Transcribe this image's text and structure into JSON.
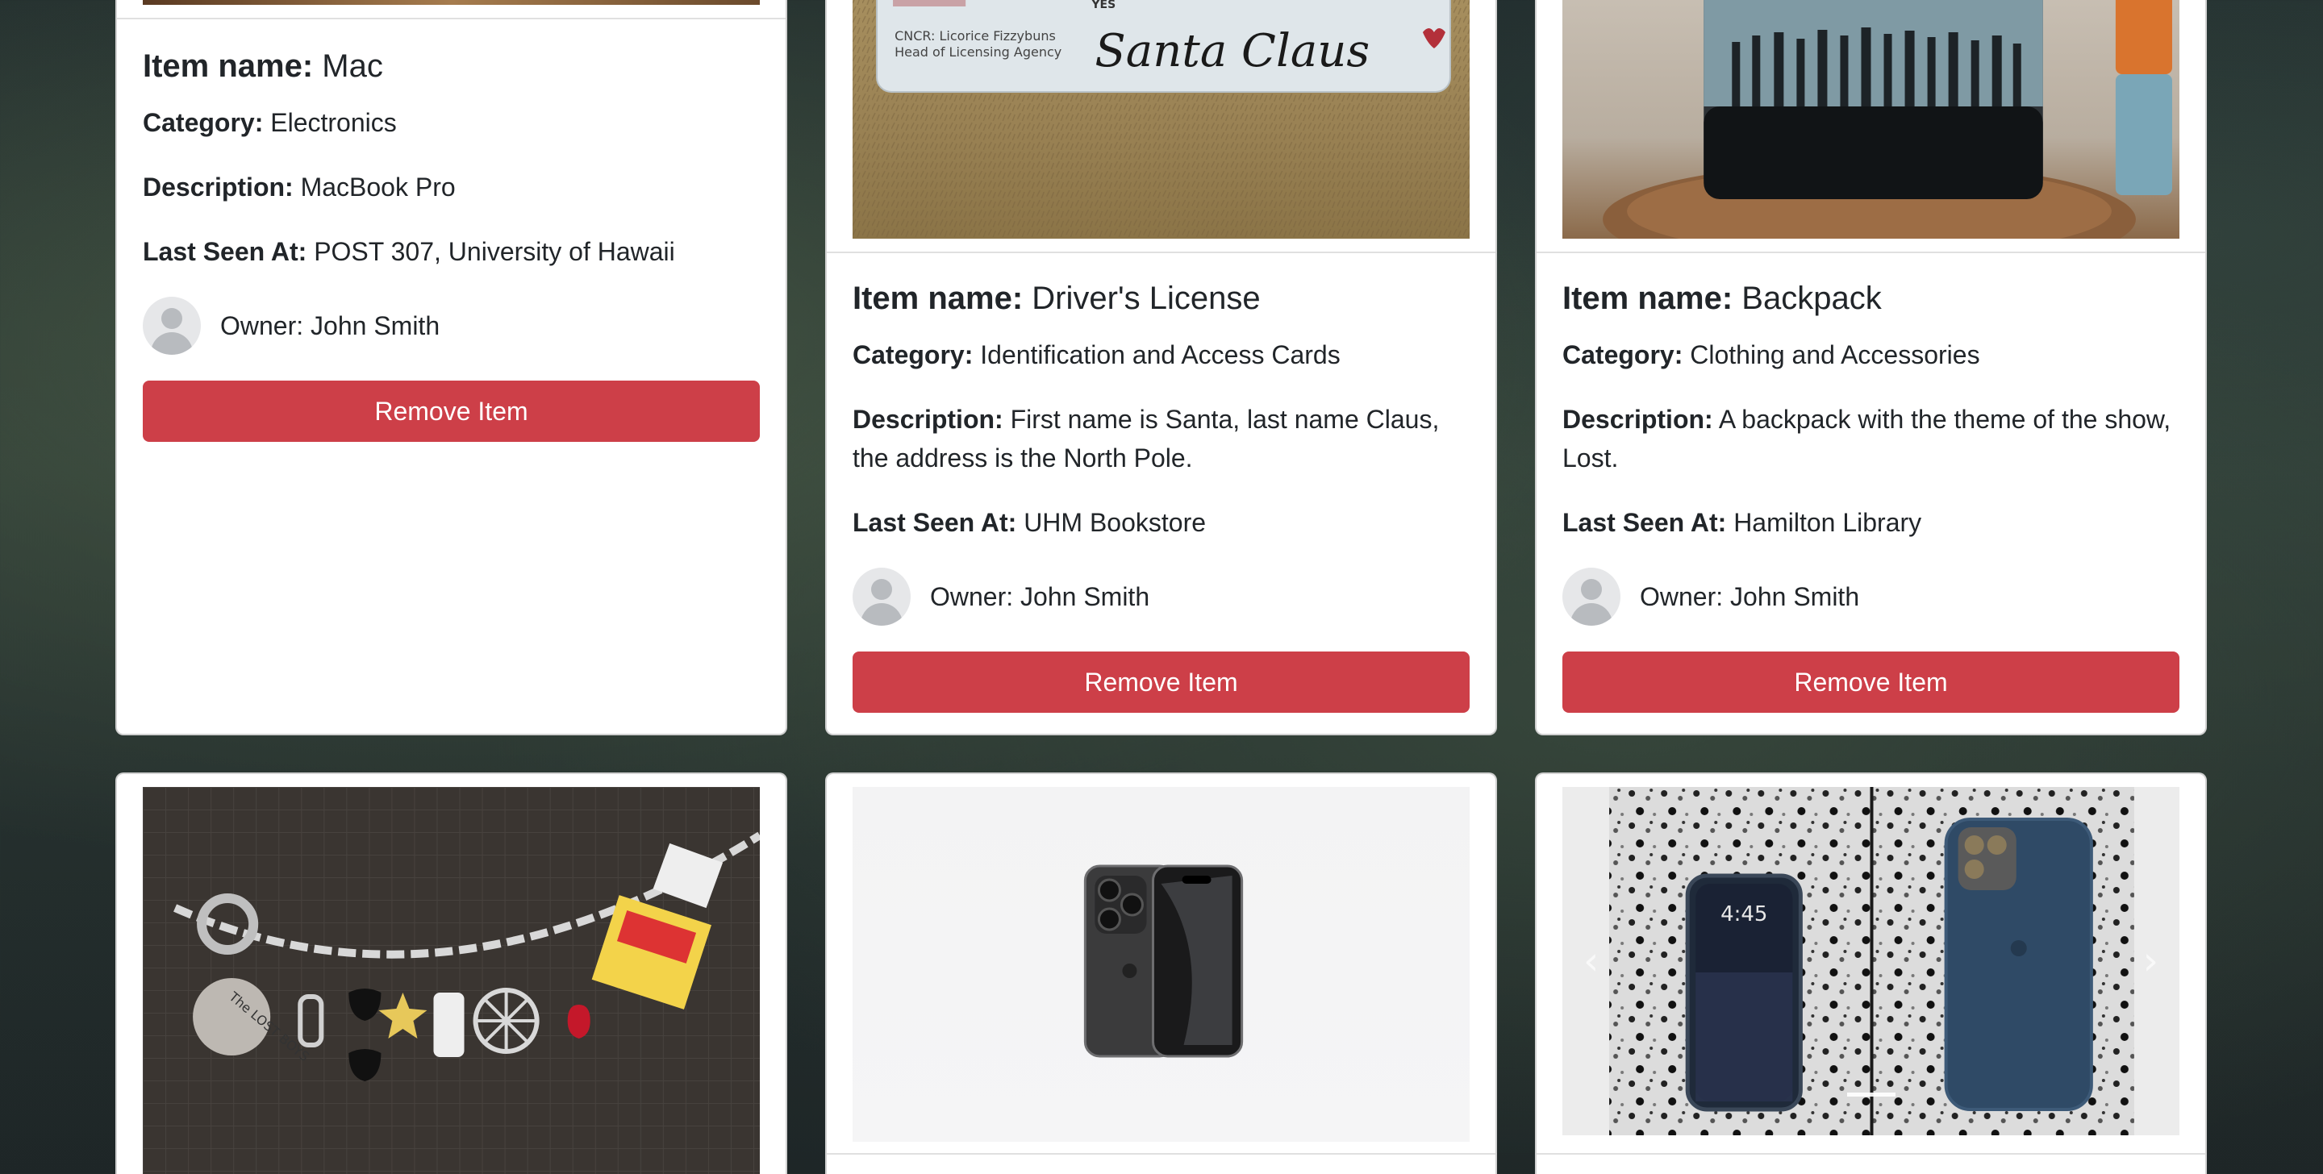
{
  "labels": {
    "item_name": "Item name:",
    "category": "Category:",
    "description": "Description:",
    "last_seen": "Last Seen At:",
    "remove_button": "Remove Item"
  },
  "items": [
    {
      "name": "Mac",
      "category": "Electronics",
      "description": "MacBook Pro",
      "last_seen": "POST 307, University of Hawaii",
      "owner": "Owner: John Smith"
    },
    {
      "name": "Driver's License",
      "category": "Identification and Access Cards",
      "description": "First name is Santa, last name Claus, the address is the North Pole.",
      "last_seen": "UHM Bookstore",
      "owner": "Owner: John Smith",
      "image_text": {
        "line1": "CNCR: Licorice Fizzybuns",
        "line2": "Head of Licensing Agency",
        "yes": "YES",
        "signature": "Santa Claus"
      }
    },
    {
      "name": "Backpack",
      "category": "Clothing and Accessories",
      "description": "A backpack with the theme of the show, Lost.",
      "last_seen": "Hamilton Library",
      "owner": "Owner: John Smith"
    }
  ],
  "bottom_cards": [
    {
      "image": "charm-bracelet-photo",
      "charm_text": "The LOST BOYS"
    },
    {
      "image": "iphone-product-photo"
    },
    {
      "image": "iphone-carousel-photo",
      "lock_time": "4:45"
    }
  ]
}
